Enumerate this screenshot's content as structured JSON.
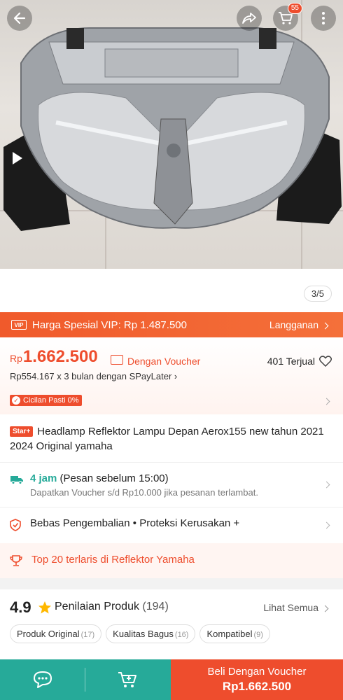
{
  "gallery": {
    "counter": "3/5"
  },
  "header": {
    "cart_badge": "55"
  },
  "vip": {
    "label": "Harga Spesial VIP: Rp 1.487.500",
    "link": "Langganan",
    "tag": "VIP"
  },
  "price": {
    "currency": "Rp",
    "amount": "1.662.500",
    "voucher_label": "Dengan Voucher",
    "sold": "401 Terjual",
    "paylater": "Rp554.167 x 3 bulan dengan SPayLater",
    "cicilan": "Cicilan Pasti 0%"
  },
  "product": {
    "star_tag": "Star+",
    "title": "Headlamp Reflektor Lampu Depan Aerox155 new tahun 2021 2024 Original yamaha"
  },
  "shipping": {
    "eta": "4 jam",
    "eta_note": "(Pesan sebelum 15:00)",
    "voucher_note": "Dapatkan Voucher s/d Rp10.000 jika pesanan terlambat."
  },
  "guarantee": {
    "text": "Bebas Pengembalian  •  Proteksi Kerusakan +"
  },
  "ranking": {
    "text": "Top 20 terlaris di Reflektor Yamaha"
  },
  "rating": {
    "score": "4.9",
    "label": "Penilaian Produk",
    "count": "(194)",
    "see_all": "Lihat Semua",
    "chips": [
      {
        "label": "Produk Original",
        "count": "(17)"
      },
      {
        "label": "Kualitas Bagus",
        "count": "(16)"
      },
      {
        "label": "Kompatibel",
        "count": "(9)"
      }
    ]
  },
  "bottom_bar": {
    "buy_line1": "Beli Dengan Voucher",
    "buy_line2": "Rp1.662.500"
  },
  "colors": {
    "primary": "#ee4d2d",
    "teal": "#26aa99"
  }
}
